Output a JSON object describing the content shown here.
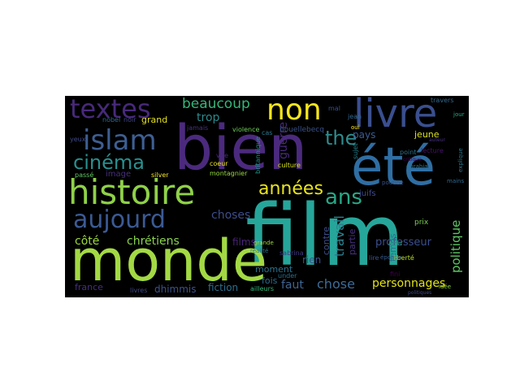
{
  "wordcloud": {
    "words": [
      {
        "text": "film",
        "color": "#26a69a"
      },
      {
        "text": "monde",
        "color": "#a3d944"
      },
      {
        "text": "bien",
        "color": "#4b2a7d"
      },
      {
        "text": "été",
        "color": "#2f6ea3"
      },
      {
        "text": "histoire",
        "color": "#8fd149"
      },
      {
        "text": "livre",
        "color": "#3a4f8f"
      },
      {
        "text": "non",
        "color": "#f7e61c"
      },
      {
        "text": "textes",
        "color": "#472a7a"
      },
      {
        "text": "islam",
        "color": "#3d5f93"
      },
      {
        "text": "aujourd",
        "color": "#3b5a94"
      },
      {
        "text": "cinéma",
        "color": "#2a8f8f"
      },
      {
        "text": "the",
        "color": "#2f8c8d"
      },
      {
        "text": "ans",
        "color": "#27a886"
      },
      {
        "text": "années",
        "color": "#e8e31f"
      },
      {
        "text": "beaucoup",
        "color": "#35b779"
      },
      {
        "text": "côté",
        "color": "#9ed93a"
      },
      {
        "text": "chrétiens",
        "color": "#8ad34d"
      },
      {
        "text": "choses",
        "color": "#3d4d8a"
      },
      {
        "text": "chose",
        "color": "#3e6c99"
      },
      {
        "text": "personnages",
        "color": "#e2e418"
      },
      {
        "text": "politique",
        "color": "#5cc863"
      },
      {
        "text": "travail",
        "color": "#2c7f8e"
      },
      {
        "text": "faut",
        "color": "#3f6593"
      },
      {
        "text": "guerre",
        "color": "#472b7a"
      },
      {
        "text": "trop",
        "color": "#2a8a8d"
      },
      {
        "text": "grand",
        "color": "#e4e21b"
      },
      {
        "text": "jeune",
        "color": "#dfe31f"
      },
      {
        "text": "pays",
        "color": "#3b5c94"
      },
      {
        "text": "professeur",
        "color": "#3a4f8d"
      },
      {
        "text": "films",
        "color": "#482475"
      },
      {
        "text": "rien",
        "color": "#3a538b"
      },
      {
        "text": "fiction",
        "color": "#2d6e8e"
      },
      {
        "text": "moment",
        "color": "#2c738e"
      },
      {
        "text": "image",
        "color": "#46307c"
      },
      {
        "text": "fois",
        "color": "#2f6b8e"
      },
      {
        "text": "contre",
        "color": "#3d4e8a"
      },
      {
        "text": "partie",
        "color": "#46327e"
      },
      {
        "text": "temps",
        "color": "#2c718e"
      },
      {
        "text": "france",
        "color": "#472f7d"
      },
      {
        "text": "dhimmis",
        "color": "#3b528b"
      },
      {
        "text": "livres",
        "color": "#3e4a89"
      },
      {
        "text": "ailleurs",
        "color": "#35b779"
      },
      {
        "text": "under",
        "color": "#2d708e"
      },
      {
        "text": "houellebecq",
        "color": "#3b528b"
      },
      {
        "text": "vite",
        "color": "#472a7a"
      },
      {
        "text": "silver",
        "color": "#f1e51d"
      },
      {
        "text": "coeur",
        "color": "#eae51a"
      },
      {
        "text": "culture",
        "color": "#d8e219"
      },
      {
        "text": "violence",
        "color": "#6ece58"
      },
      {
        "text": "montagnier",
        "color": "#95d840"
      },
      {
        "text": "jamais",
        "color": "#46327e"
      },
      {
        "text": "passé",
        "color": "#5ec962"
      },
      {
        "text": "yeux",
        "color": "#3e4989"
      },
      {
        "text": "réalité",
        "color": "#2a788e"
      },
      {
        "text": "point",
        "color": "#2c728e"
      },
      {
        "text": "jean",
        "color": "#31688e"
      },
      {
        "text": "liberté",
        "color": "#b5de2b"
      },
      {
        "text": "prix",
        "color": "#7ad151"
      },
      {
        "text": "mal",
        "color": "#3b528b"
      },
      {
        "text": "noir",
        "color": "#414487"
      },
      {
        "text": "grande",
        "color": "#9fda3a"
      },
      {
        "text": "lecture",
        "color": "#471365"
      },
      {
        "text": "époque",
        "color": "#365c8d"
      },
      {
        "text": "aller",
        "color": "#29af7f"
      },
      {
        "text": "cas",
        "color": "#2a788e"
      },
      {
        "text": "oui",
        "color": "#fde725"
      },
      {
        "text": "lire",
        "color": "#3b528b"
      },
      {
        "text": "travers",
        "color": "#31688e"
      },
      {
        "text": "sujet",
        "color": "#26828e"
      },
      {
        "text": "britannique",
        "color": "#1f988b"
      },
      {
        "text": "fini",
        "color": "#440154"
      },
      {
        "text": "juifs",
        "color": "#3e4989"
      },
      {
        "text": "sabrina",
        "color": "#443983"
      },
      {
        "text": "explique",
        "color": "#2a788e"
      },
      {
        "text": "mains",
        "color": "#31688e"
      },
      {
        "text": "idée",
        "color": "#8fd744"
      },
      {
        "text": "jour",
        "color": "#22a884"
      },
      {
        "text": "poutine",
        "color": "#3b528b"
      },
      {
        "text": "nobel",
        "color": "#31688e"
      },
      {
        "text": "eurabia",
        "color": "#2a788e"
      },
      {
        "text": "politiques",
        "color": "#3e4989"
      },
      {
        "text": "auteur",
        "color": "#46327e"
      },
      {
        "text": "critique",
        "color": "#440154"
      }
    ]
  }
}
